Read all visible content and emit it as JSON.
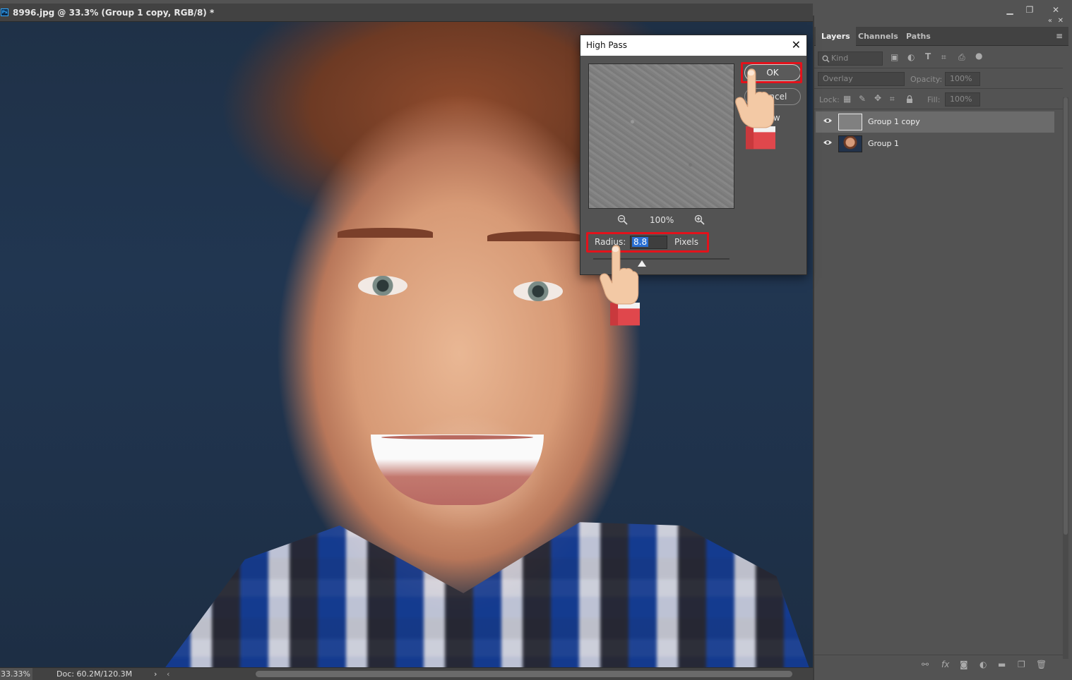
{
  "document": {
    "tab_title": "8996.jpg @ 33.3% (Group 1 copy, RGB/8) *",
    "app_badge": "Ps"
  },
  "window_controls": {
    "minimize": "▁",
    "restore": "❐",
    "close": "✕"
  },
  "status_bar": {
    "zoom": "33.33%",
    "doc_size": "Doc: 60.2M/120.3M",
    "arrow": "›",
    "scroll_left": "‹"
  },
  "layers_panel": {
    "collapse": "«",
    "close": "✕",
    "tabs": [
      {
        "label": "Layers",
        "active": true
      },
      {
        "label": "Channels",
        "active": false
      },
      {
        "label": "Paths",
        "active": false
      }
    ],
    "menu": "≡",
    "filter_kind": "Kind",
    "blend_mode": "Overlay",
    "opacity_label": "Opacity:",
    "opacity_value": "100%",
    "lock_label": "Lock:",
    "fill_label": "Fill:",
    "fill_value": "100%",
    "layers": [
      {
        "name": "Group 1 copy",
        "selected": true
      },
      {
        "name": "Group 1",
        "selected": false
      }
    ]
  },
  "high_pass_dialog": {
    "title": "High Pass",
    "close": "✕",
    "ok_label": "OK",
    "cancel_label": "Cancel",
    "preview_label": "Preview",
    "zoom_percent": "100%",
    "radius_label": "Radius:",
    "radius_value": "8.8",
    "radius_unit": "Pixels",
    "radius_slider_fraction": 0.36
  },
  "colors": {
    "highlight": "#e3121b",
    "selection": "#2a6fd3",
    "panel_bg": "#535353"
  },
  "icons": {
    "zoom_out": "zoom-out-icon",
    "zoom_in": "zoom-in-icon",
    "eye": "eye-icon",
    "hand": "pointing-hand-icon"
  }
}
